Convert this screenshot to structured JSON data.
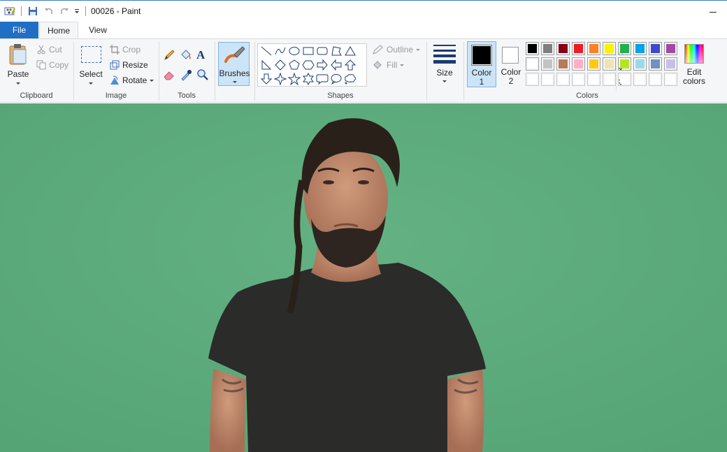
{
  "window": {
    "title": "00026 - Paint"
  },
  "tabs": {
    "file": "File",
    "home": "Home",
    "view": "View"
  },
  "clipboard": {
    "paste": "Paste",
    "cut": "Cut",
    "copy": "Copy",
    "label": "Clipboard"
  },
  "image": {
    "select": "Select",
    "crop": "Crop",
    "resize": "Resize",
    "rotate": "Rotate",
    "label": "Image"
  },
  "tools": {
    "label": "Tools",
    "items": [
      "pencil-icon",
      "fill-bucket-icon",
      "text-icon",
      "eraser-icon",
      "color-picker-icon",
      "magnifier-icon"
    ]
  },
  "brushes": {
    "label": "Brushes"
  },
  "shapes": {
    "label": "Shapes",
    "outline": "Outline",
    "fill": "Fill"
  },
  "size": {
    "label": "Size"
  },
  "colors": {
    "color1_line1": "Color",
    "color1_line2": "1",
    "color2_line1": "Color",
    "color2_line2": "2",
    "edit_line1": "Edit",
    "edit_line2": "colors",
    "label": "Colors",
    "color1": "#000000",
    "color2": "#ffffff",
    "palette_row1": [
      "#000000",
      "#7f7f7f",
      "#880015",
      "#ed1c24",
      "#ff7f27",
      "#fff200",
      "#22b14c",
      "#00a2e8",
      "#3f48cc",
      "#a349a4"
    ],
    "palette_row2": [
      "#ffffff",
      "#c3c3c3",
      "#b97a57",
      "#ffaec9",
      "#ffc90e",
      "#efe4b0",
      "#b5e61d",
      "#99d9ea",
      "#7092be",
      "#c8bfe7"
    ],
    "palette_row3": [
      "#ffffff",
      "#ffffff",
      "#ffffff",
      "#ffffff",
      "#ffffff",
      "#ffffff",
      "#ffffff",
      "#ffffff",
      "#ffffff",
      "#ffffff"
    ]
  },
  "canvas": {
    "background": "#5dab7c"
  }
}
